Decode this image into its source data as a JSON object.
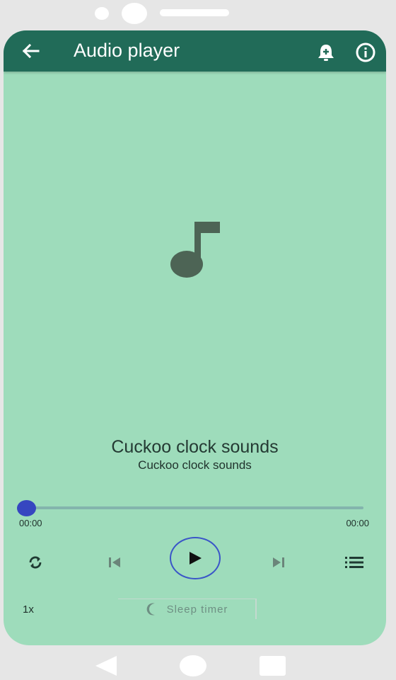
{
  "app_bar": {
    "title": "Audio player",
    "back_icon": "arrow-back-icon",
    "alarm_icon": "alarm-add-icon",
    "info_icon": "info-icon",
    "background": "#216b58"
  },
  "artwork": {
    "icon": "music-note-icon",
    "color": "#4d6455"
  },
  "track": {
    "title": "Cuckoo clock sounds",
    "artist": "Cuckoo clock sounds"
  },
  "progress": {
    "current_time": "00:00",
    "total_time": "00:00",
    "position_fraction": 0,
    "thumb_color": "#3646c0"
  },
  "controls": {
    "repeat_icon": "repeat-icon",
    "previous_icon": "skip-previous-icon",
    "play_icon": "play-icon",
    "next_icon": "skip-next-icon",
    "queue_icon": "playlist-icon"
  },
  "footer": {
    "speed": "1x",
    "sleep_timer_icon": "moon-icon",
    "sleep_timer_label": "Sleep timer"
  },
  "colors": {
    "screen_background": "#9edcbb",
    "accent": "#3a55c8"
  }
}
